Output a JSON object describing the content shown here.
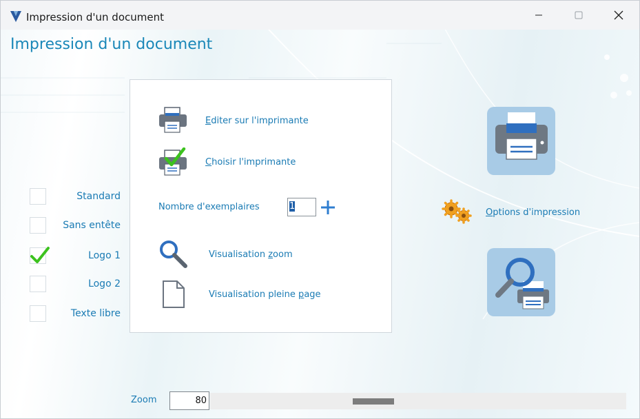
{
  "window": {
    "title": "Impression d'un document"
  },
  "heading": "Impression d'un document",
  "options": [
    {
      "label": "Standard",
      "checked": false
    },
    {
      "label": "Sans entête",
      "checked": false
    },
    {
      "label": "Logo 1",
      "checked": true
    },
    {
      "label": "Logo 2",
      "checked": false
    },
    {
      "label": "Texte libre",
      "checked": false
    }
  ],
  "panel": {
    "print_link": {
      "accel": "E",
      "rest": "diter sur l'imprimante"
    },
    "choose_link": {
      "accel": "C",
      "rest": "hoisir l'imprimante"
    },
    "copies_label": "Nombre d'exemplaires",
    "copies_value": "1",
    "preview_zoom": {
      "before": "Visualisation ",
      "accel": "z",
      "after": "oom"
    },
    "preview_page": {
      "before": "Visualisation pleine ",
      "accel": "p",
      "after": "age"
    }
  },
  "options_link": {
    "accel": "O",
    "rest": "ptions d'impression"
  },
  "zoom": {
    "label": "Zoom",
    "value": "80",
    "slider_fraction": 0.38
  },
  "icons": {
    "app": "app-logo-icon",
    "printer": "printer-icon",
    "printer_check": "printer-check-icon",
    "plus": "plus-icon",
    "magnifier": "magnifier-icon",
    "page": "page-icon",
    "gears": "gears-icon",
    "big_printer": "big-printer-icon",
    "big_preview": "big-preview-icon"
  },
  "colors": {
    "accent": "#1a87b8",
    "link": "#1a7bb4",
    "tile": "#a8cbe6",
    "check": "#3cc21e"
  }
}
